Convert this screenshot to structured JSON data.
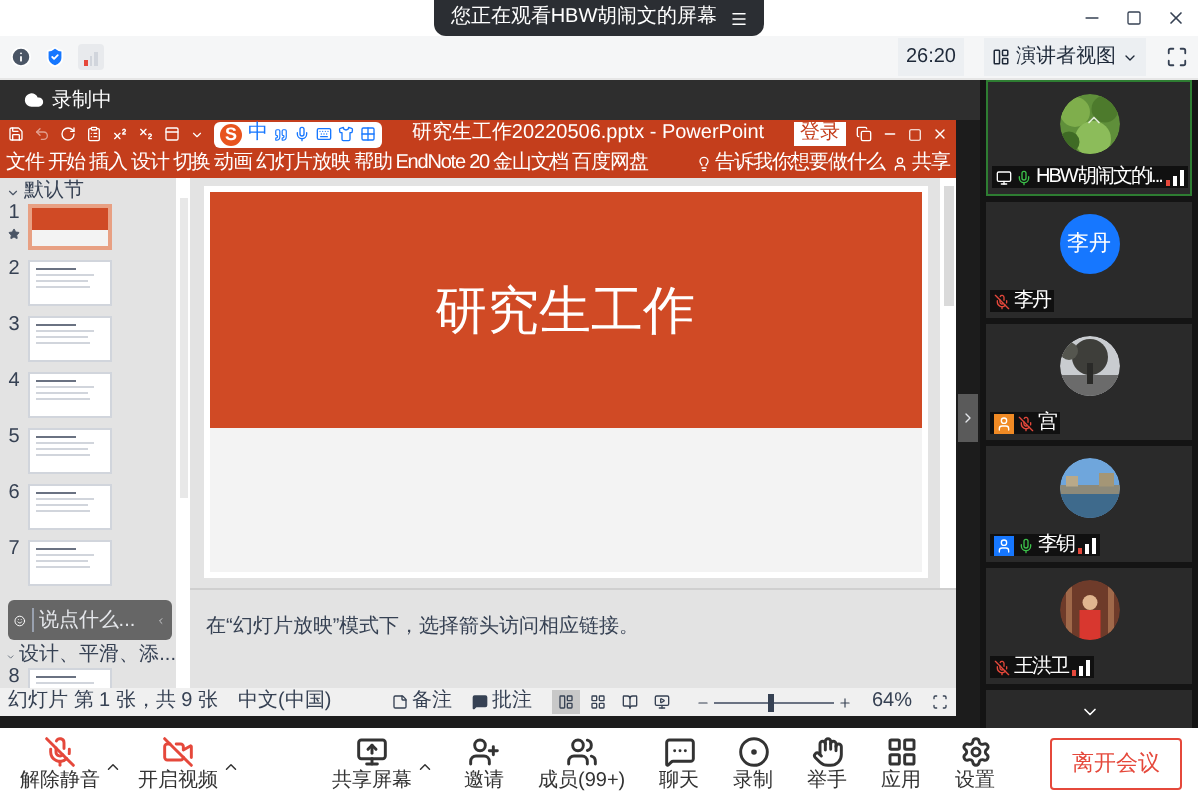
{
  "banner": {
    "text": "您正在观看HBW胡闹文的屏幕"
  },
  "toolbar": {
    "timer": "26:20",
    "view_button": "演讲者视图"
  },
  "recording": {
    "label": "录制中"
  },
  "powerpoint": {
    "title": "研究生工作20220506.pptx - PowerPoint",
    "sign_in": "登录",
    "ime": {
      "logo": "S",
      "mode": "中"
    },
    "ribbon_tabs": [
      {
        "label": "文件"
      },
      {
        "label": "开始"
      },
      {
        "label": "插入"
      },
      {
        "label": "设计"
      },
      {
        "label": "切换"
      },
      {
        "label": "动画"
      },
      {
        "label": "幻灯片放映"
      },
      {
        "label": "帮助"
      },
      {
        "label": "EndNote 20"
      },
      {
        "label": "金山文档"
      },
      {
        "label": "百度网盘"
      }
    ],
    "tell_me": "告诉我你想要做什么",
    "share": "共享",
    "thumbnails": [
      {
        "kind": "section",
        "label": "默认节"
      },
      {
        "kind": "slide",
        "number": "1",
        "selected": true,
        "animated": true
      },
      {
        "kind": "slide",
        "number": "2",
        "selected": false,
        "animated": false
      },
      {
        "kind": "slide",
        "number": "3",
        "selected": false,
        "animated": false
      },
      {
        "kind": "slide",
        "number": "4",
        "selected": false,
        "animated": false
      },
      {
        "kind": "slide",
        "number": "5",
        "selected": false,
        "animated": false
      },
      {
        "kind": "slide",
        "number": "6",
        "selected": false,
        "animated": false
      },
      {
        "kind": "slide",
        "number": "7",
        "selected": false,
        "animated": false
      },
      {
        "kind": "section",
        "label": "设计、平滑、添..."
      },
      {
        "kind": "slide",
        "number": "8",
        "selected": false,
        "animated": false
      }
    ],
    "slide": {
      "title": "研究生工作"
    },
    "notes": "在“幻灯片放映”模式下，选择箭头访问相应链接。",
    "status": {
      "slide_info": "幻灯片 第 1 张，共 9 张",
      "language": "中文(中国)",
      "notes_button": "备注",
      "comments_button": "批注",
      "views": [
        {
          "kind": "normal",
          "selected": true
        },
        {
          "kind": "sorter",
          "selected": false
        },
        {
          "kind": "reading",
          "selected": false
        },
        {
          "kind": "slideshow",
          "selected": false
        }
      ],
      "zoom": {
        "level": 0.45,
        "reading": "64%"
      }
    }
  },
  "chat": {
    "placeholder": "说点什么..."
  },
  "participants": [
    {
      "name": "HBW胡闹文的i...",
      "muted": false,
      "sharing": true,
      "signal": true
    },
    {
      "name": "李丹",
      "avatar": {
        "kind": "initials",
        "text": "李丹"
      },
      "muted": true,
      "sharing": false,
      "signal": false
    },
    {
      "name": "宫",
      "muted": true,
      "sharing": false,
      "signal": false,
      "badge": {
        "color": "#f08a24"
      }
    },
    {
      "name": "李钥",
      "muted": false,
      "sharing": false,
      "signal": true,
      "badge": {
        "color": "#1677ff"
      }
    },
    {
      "name": "王洪卫",
      "muted": true,
      "sharing": false,
      "signal": true
    }
  ],
  "meeting_controls": [
    {
      "kind": "mic",
      "label": "解除静音",
      "off": true,
      "menu": true
    },
    {
      "kind": "video",
      "label": "开启视频",
      "off": true,
      "menu": true
    },
    {
      "kind": "share",
      "label": "共享屏幕",
      "off": false,
      "menu": true
    },
    {
      "kind": "invite",
      "label": "邀请",
      "off": false,
      "menu": false
    },
    {
      "kind": "members",
      "label": "成员(99+)",
      "off": false,
      "menu": false
    },
    {
      "kind": "chat",
      "label": "聊天",
      "off": false,
      "menu": false
    },
    {
      "kind": "record",
      "label": "录制",
      "off": false,
      "menu": false
    },
    {
      "kind": "hand",
      "label": "举手",
      "off": false,
      "menu": false
    },
    {
      "kind": "apps",
      "label": "应用",
      "off": false,
      "menu": false
    },
    {
      "kind": "settings",
      "label": "设置",
      "off": false,
      "menu": false
    }
  ],
  "leave_button": "离开会议"
}
